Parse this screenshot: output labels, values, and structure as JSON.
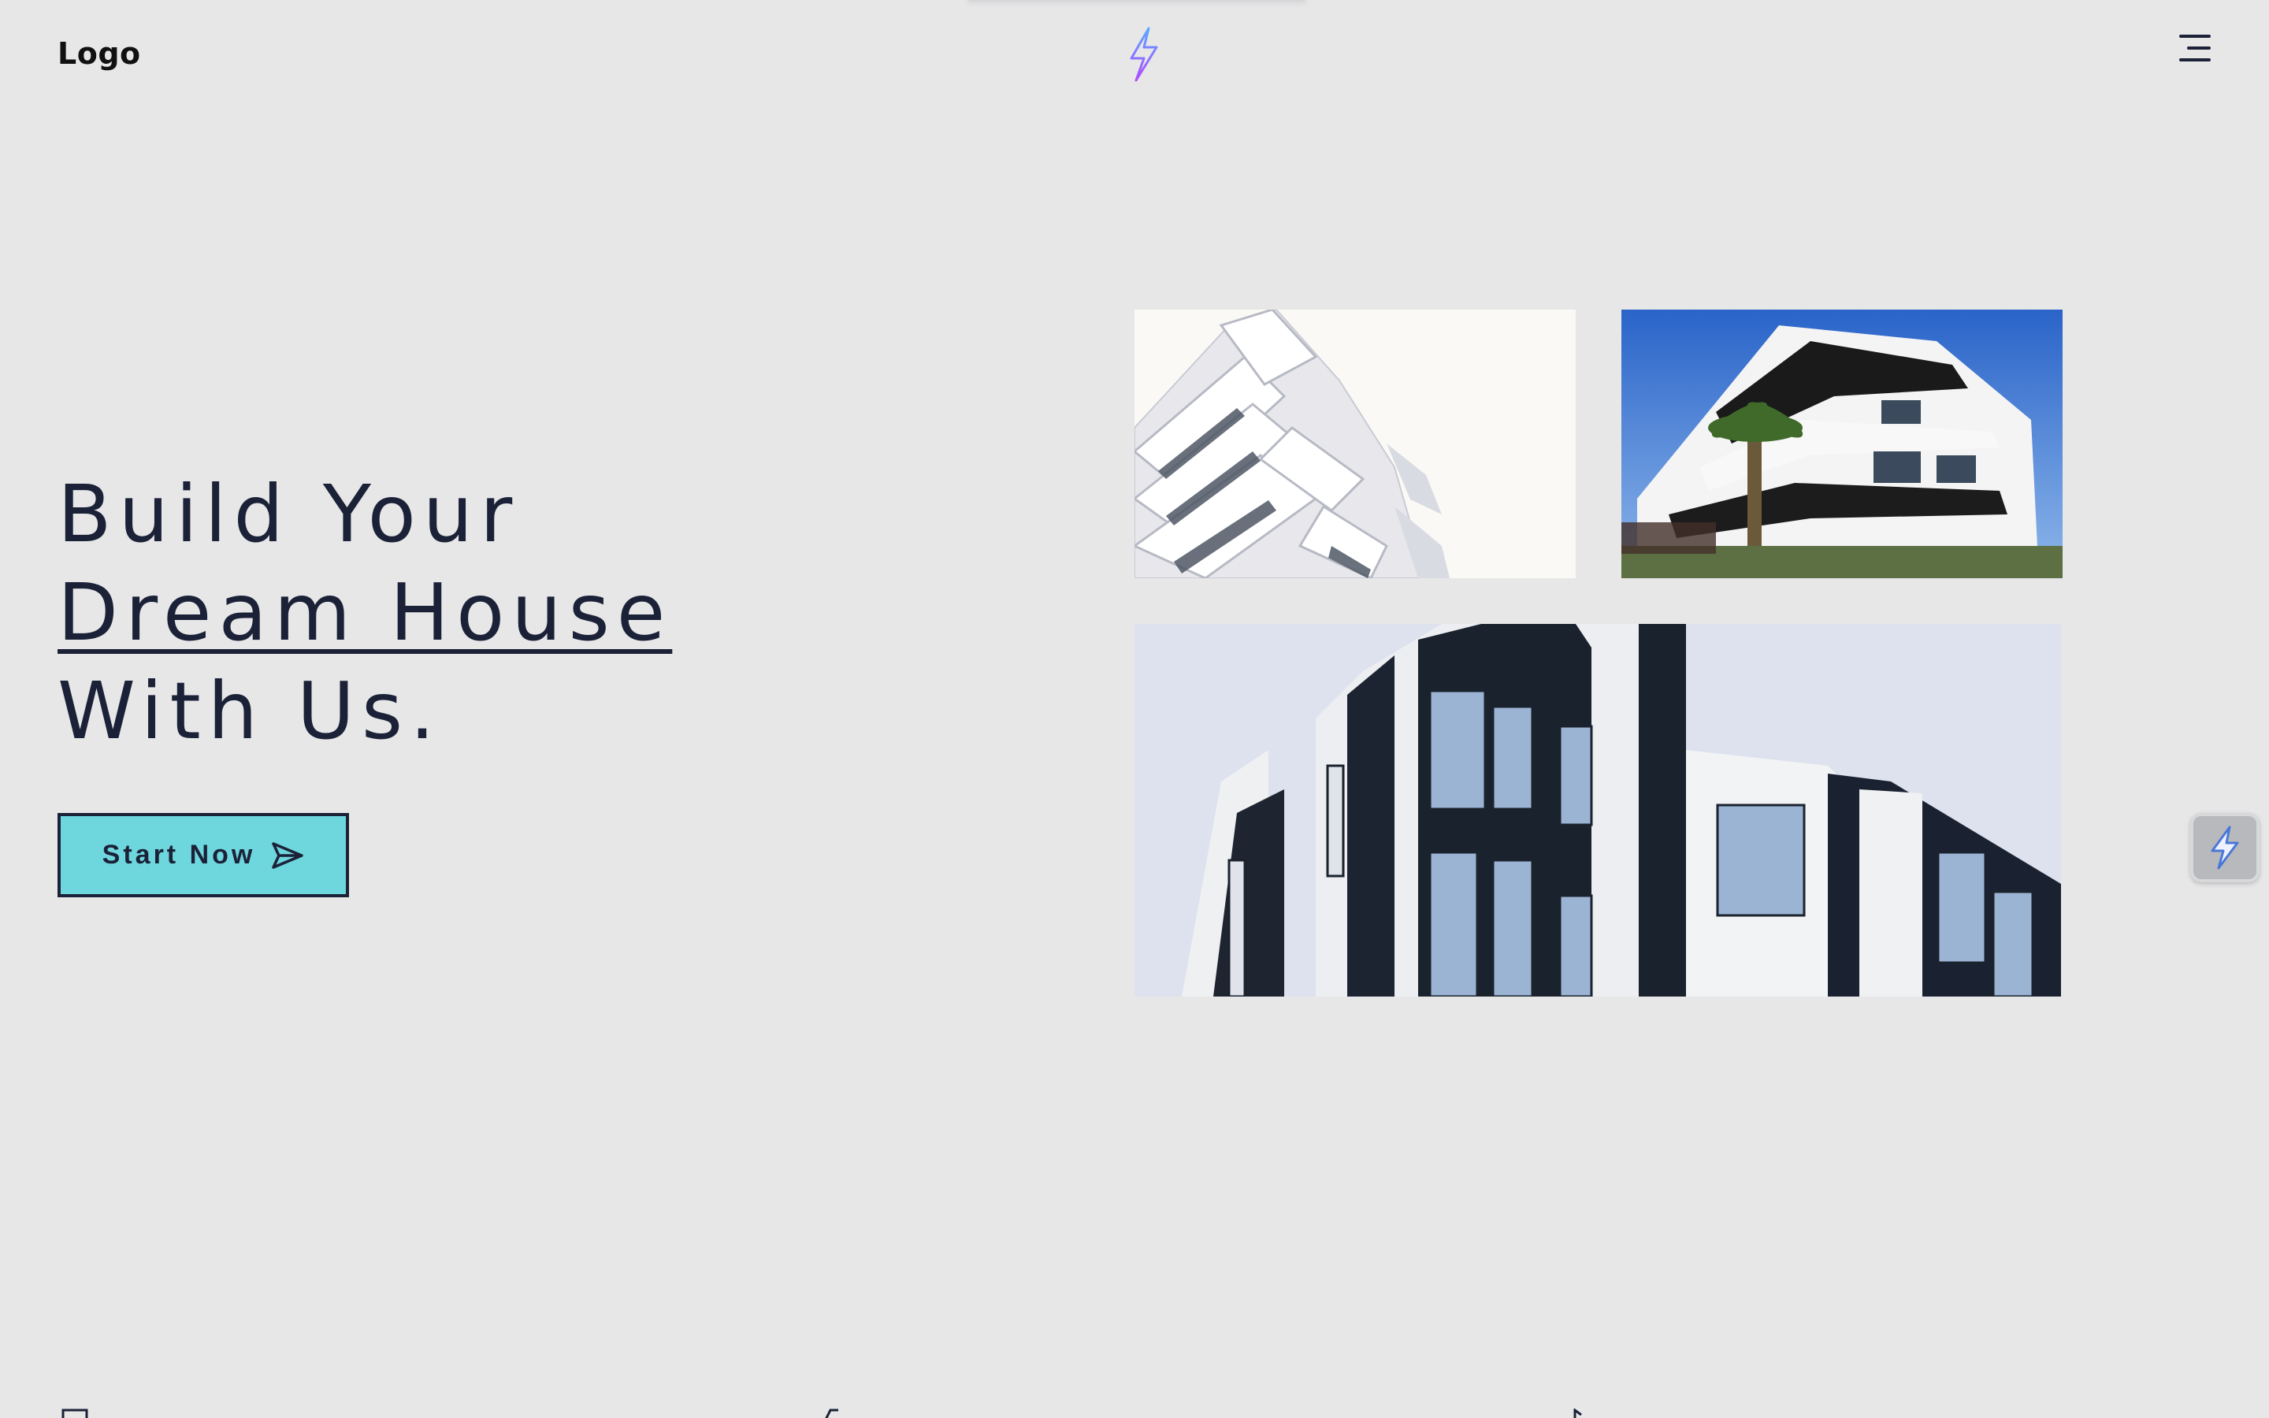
{
  "header": {
    "logo_text": "Logo",
    "center_icon": "lightning-bolt-icon",
    "menu_icon": "hamburger-menu-icon"
  },
  "hero": {
    "title_line1": "Build Your",
    "title_line2": "Dream House",
    "title_line3": "With Us.",
    "cta_label": "Start Now",
    "cta_icon": "send-icon"
  },
  "gallery": {
    "images": [
      "modern-white-building-photo",
      "white-apartment-with-palm-photo",
      "dark-glass-building-photo"
    ]
  },
  "floating_widget": {
    "icon": "bolt-badge-icon"
  },
  "colors": {
    "background": "#e7e7e8",
    "text": "#1b2238",
    "cta_background": "#6ed7dd",
    "bolt_gradient_start": "#5aa8ff",
    "bolt_gradient_end": "#b14cff"
  }
}
